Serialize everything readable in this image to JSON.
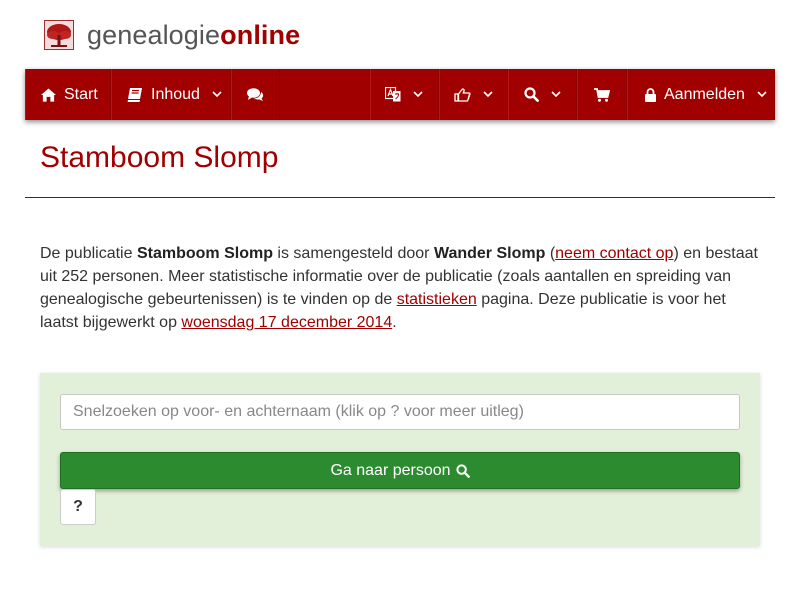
{
  "brand": {
    "prefix": "genealogie",
    "suffix": "online"
  },
  "nav": {
    "start_label": "Start",
    "inhoud_label": "Inhoud",
    "login_label": "Aanmelden"
  },
  "page": {
    "title": "Stamboom Slomp"
  },
  "intro": {
    "t1": "De publicatie ",
    "publication": "Stamboom Slomp",
    "t2": " is samengesteld door ",
    "author": "Wander Slomp",
    "t3": " (",
    "contact_link": "neem contact op",
    "t4": ") en bestaat uit 252 personen. Meer statistische informatie over de publicatie (zoals aantallen en spreiding van genealogische gebeurtenissen) is te vinden op de ",
    "stats_link": "statistieken",
    "t5": " pagina. Deze publicatie is voor het laatst bijgewerkt op ",
    "date_link": "woensdag 17 december 2014",
    "t6": "."
  },
  "search": {
    "placeholder": "Snelzoeken op voor- en achternaam (klik op ? voor meer uitleg)",
    "value": "",
    "button_label": "Ga naar persoon",
    "help_label": "?"
  },
  "colors": {
    "brand_red": "#a00000",
    "nav_bg": "#a10000",
    "panel_bg": "#e3f0d9",
    "button_green": "#2c8a2f"
  },
  "icons": [
    "tree-logo-icon",
    "home-icon",
    "book-icon",
    "comments-icon",
    "language-icon",
    "hand-point-icon",
    "search-icon",
    "shopping-cart-icon",
    "lock-icon",
    "chevron-down-icon"
  ]
}
